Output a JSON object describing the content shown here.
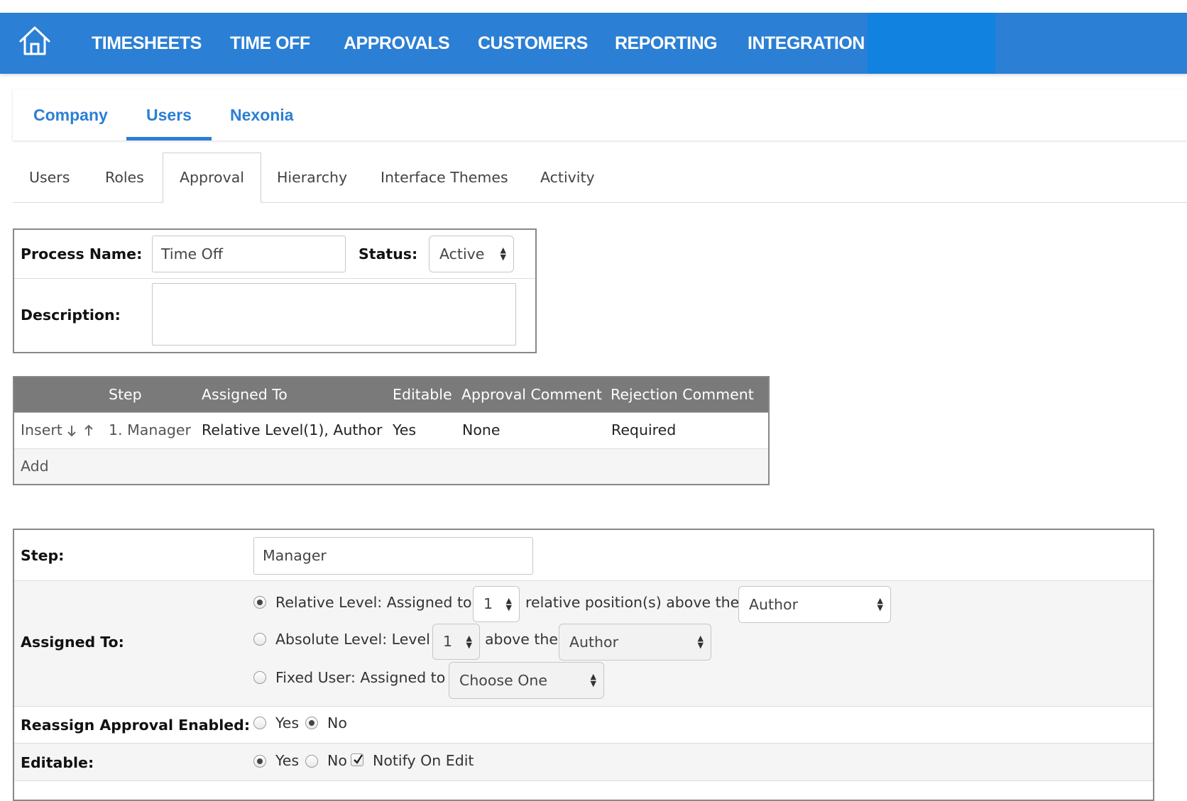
{
  "topnav": {
    "items": [
      "TIMESHEETS",
      "TIME OFF",
      "APPROVALS",
      "CUSTOMERS",
      "REPORTING",
      "INTEGRATION"
    ]
  },
  "tabs1": [
    "Company",
    "Users",
    "Nexonia"
  ],
  "tabs1_active": "Users",
  "tabs2": [
    "Users",
    "Roles",
    "Approval",
    "Hierarchy",
    "Interface Themes",
    "Activity"
  ],
  "tabs2_active": "Approval",
  "process": {
    "name_label": "Process Name:",
    "name_value": "Time Off",
    "status_label": "Status:",
    "status_value": "Active",
    "description_label": "Description:",
    "description_value": ""
  },
  "steps_table": {
    "headers": [
      "",
      "Step",
      "Assigned To",
      "Editable",
      "Approval Comment",
      "Rejection Comment"
    ],
    "rows": [
      {
        "insert": "Insert",
        "step": "1. Manager",
        "assigned_to": "Relative Level(1), Author",
        "editable": "Yes",
        "approval_comment": "None",
        "rejection_comment": "Required"
      }
    ],
    "add_label": "Add"
  },
  "step_form": {
    "step_label": "Step:",
    "step_value": "Manager",
    "assigned_label": "Assigned To:",
    "relative": {
      "text1": "Relative Level: Assigned to",
      "level": "1",
      "text2": "relative position(s) above the",
      "ref": "Author",
      "selected": true
    },
    "absolute": {
      "text1": "Absolute Level: Level",
      "level": "1",
      "text2": "above the",
      "ref": "Author",
      "selected": false
    },
    "fixed": {
      "text1": "Fixed User: Assigned to",
      "user": "Choose One",
      "selected": false
    },
    "reassign_label": "Reassign Approval Enabled:",
    "reassign_yes": "Yes",
    "reassign_no": "No",
    "reassign_value": "No",
    "editable_label": "Editable:",
    "editable_yes": "Yes",
    "editable_no": "No",
    "editable_value": "Yes",
    "notify_label": "Notify On Edit",
    "notify_checked": true
  }
}
